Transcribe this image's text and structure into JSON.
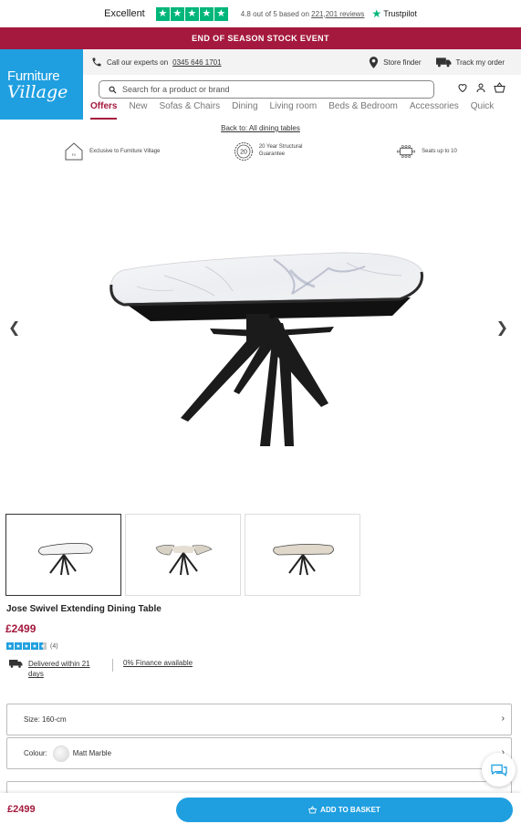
{
  "trustpilot": {
    "excellent": "Excellent",
    "score_text": "4.8 out of 5 based on",
    "reviews_link": "221,201 reviews",
    "brand": "Trustpilot",
    "color": "#00b67a"
  },
  "promo": {
    "text": "END OF SEASON STOCK EVENT",
    "color": "#a4193d"
  },
  "header": {
    "logo_line1": "Furniture",
    "logo_line2": "Village",
    "call_text": "Call our experts on",
    "phone": "0345 646 1701",
    "store_finder": "Store finder",
    "track_order": "Track my order",
    "search_placeholder": "Search for a product or brand",
    "brand_color": "#1f9fe0"
  },
  "nav": {
    "items": [
      "Offers",
      "New",
      "Sofas & Chairs",
      "Dining",
      "Living room",
      "Beds & Bedroom",
      "Accessories",
      "Quick"
    ]
  },
  "breadcrumb": {
    "back": "Back to: All dining tables"
  },
  "usps": [
    {
      "text": "Exclusive to Furniture Village",
      "icon": "house-icon"
    },
    {
      "text": "20 Year Structural Guarantee",
      "icon": "guarantee-badge-icon",
      "badge": "20"
    },
    {
      "text": "Seats up to 10",
      "icon": "table-seating-icon"
    }
  ],
  "product": {
    "title": "Jose Swivel Extending Dining Table",
    "price": "£2499",
    "rating": 4.5,
    "review_count": "(4)",
    "delivery": "Delivered within 21 days",
    "finance": "0% Finance available",
    "size_label": "Size:",
    "size_value": "160-cm",
    "colour_label": "Colour:",
    "colour_value": "Matt Marble"
  },
  "sticky": {
    "price": "£2499",
    "add_to_basket": "ADD TO BASKET"
  }
}
